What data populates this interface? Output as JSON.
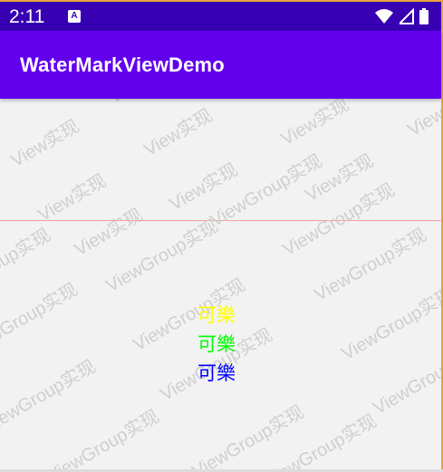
{
  "status_bar": {
    "time": "2:11",
    "notification_icon": "android-a-icon",
    "icons": [
      "wifi-icon",
      "cellular-signal-icon",
      "battery-icon"
    ]
  },
  "app_bar": {
    "title": "WaterMarkViewDemo"
  },
  "watermarks": {
    "view": "View实现",
    "viewgroup": "ViewGroup实现"
  },
  "content": {
    "labels": [
      {
        "text": "可樂",
        "color": "#ffff00"
      },
      {
        "text": "可樂",
        "color": "#00ff00"
      },
      {
        "text": "可樂",
        "color": "#0000ff"
      }
    ],
    "divider_color": "#f4a0a0"
  },
  "colors": {
    "status_bar": "#3700b3",
    "app_bar": "#6200ee",
    "background": "#f2f2f2",
    "watermark": "#cfcfcf"
  }
}
